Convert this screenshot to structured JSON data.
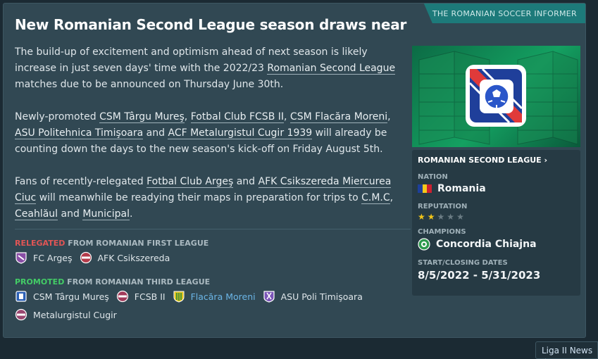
{
  "source": "THE ROMANIAN SOCCER INFORMER",
  "headline": "New Romanian Second League season draws near",
  "paragraphs": {
    "p1": {
      "t1": "The build-up of excitement and optimism ahead of next season is likely increase in just seven days' time with the 2022/23 ",
      "l1": "Romanian Second League",
      "t2": " matches due to be announced on Thursday June 30th."
    },
    "p2": {
      "t1": "Newly-promoted ",
      "l1": "CSM Târgu Mureş",
      "s1": ", ",
      "l2": "Fotbal Club FCSB II",
      "s2": ", ",
      "l3": "CSM Flacăra Moreni",
      "s3": ", ",
      "l4": "ASU Politehnica Timişoara",
      "s4": " and ",
      "l5": "ACF Metalurgistul Cugir 1939",
      "t2": " will already be counting down the days to the new season's kick-off on Friday August 5th."
    },
    "p3": {
      "t1": "Fans of recently-relegated ",
      "l1": "Fotbal Club Argeş",
      "s1": " and ",
      "l2": "AFK Csikszereda Miercurea Ciuc",
      "t2": " will meanwhile be readying their maps in preparation for trips to ",
      "l3": "C.M.C",
      "s2": ", ",
      "l4": "Ceahlăul",
      "s3": " and ",
      "l5": "Municipal",
      "t3": "."
    }
  },
  "relegated": {
    "tag": "RELEGATED",
    "rest": " FROM ROMANIAN FIRST LEAGUE",
    "teams": [
      "FC Argeş",
      "AFK Csikszereda"
    ]
  },
  "promoted": {
    "tag": "PROMOTED",
    "rest": " FROM ROMANIAN THIRD LEAGUE",
    "teams": [
      "CSM Târgu Mureş",
      "FCSB II",
      "Flacăra Moreni",
      "ASU Poli Timişoara",
      "Metalurgistul Cugir"
    ]
  },
  "card": {
    "title": "ROMANIAN SECOND LEAGUE",
    "nation_label": "NATION",
    "nation": "Romania",
    "reputation_label": "REPUTATION",
    "reputation_stars": 2,
    "reputation_max": 5,
    "champions_label": "CHAMPIONS",
    "champions": "Concordia Chiajna",
    "dates_label": "START/CLOSING DATES",
    "dates": "8/5/2022 - 5/31/2023"
  },
  "footer_button": "Liga II News",
  "colors": {
    "relegated": "#e05555",
    "promoted": "#43cc66",
    "accent": "#1d7a7a",
    "star_on": "#f0c419",
    "star_off": "#6b7c84"
  }
}
